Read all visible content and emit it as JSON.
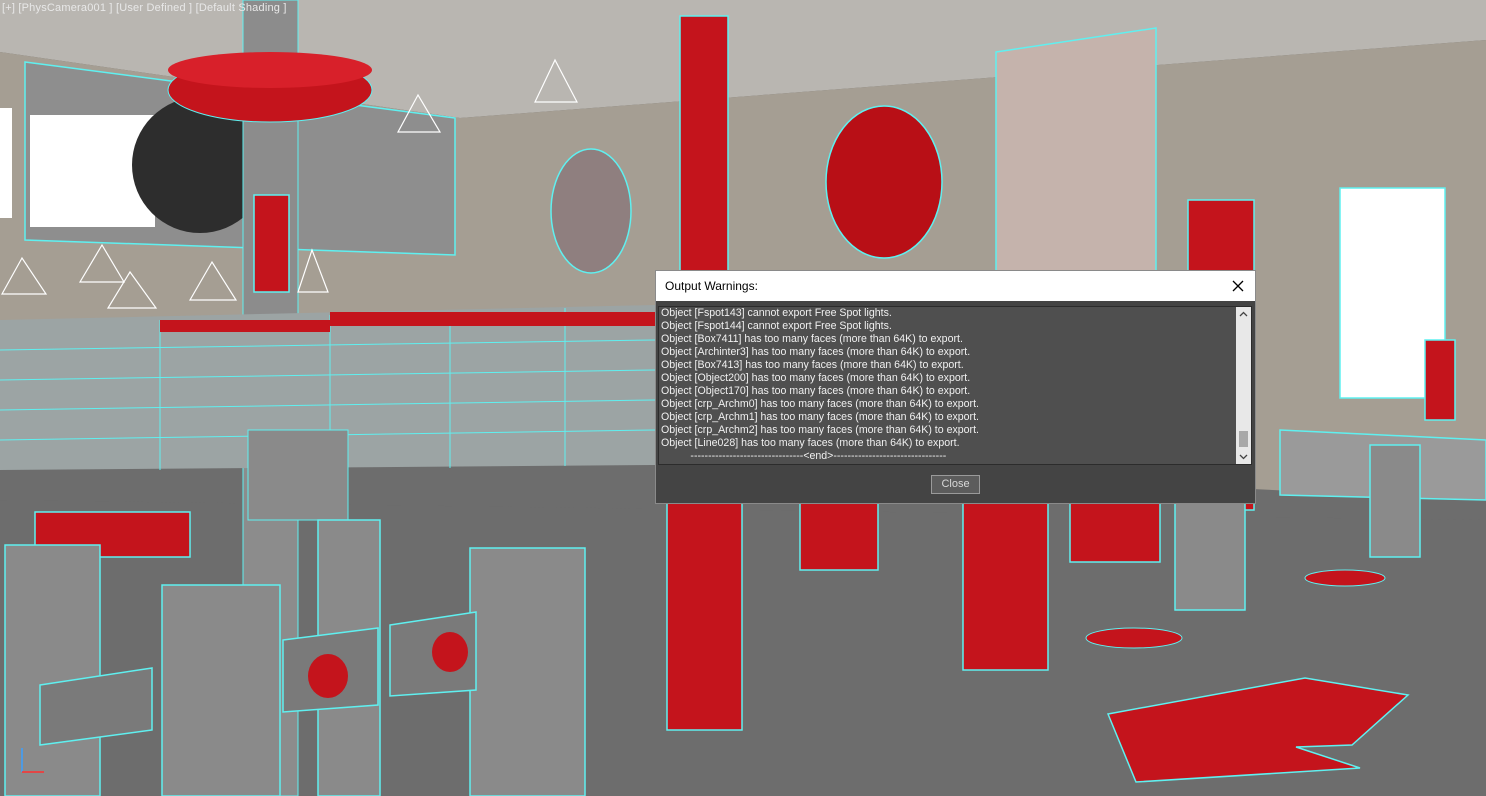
{
  "viewport": {
    "label": "[+] [PhysCamera001 ] [User Defined ] [Default Shading ]",
    "colors": {
      "floor": "#6d6d6d",
      "wall": "#a59e93",
      "ceiling": "#b9b6b1",
      "accent_red": "#d4101a",
      "wire": "#5ff0f0"
    }
  },
  "dialog": {
    "title": "Output Warnings:",
    "close_icon": "close-icon",
    "lines": [
      "Object [Fspot143] cannot export Free Spot lights.",
      "Object [Fspot144] cannot export Free Spot lights.",
      "Object [Box7411] has too many faces (more than 64K) to export.",
      "Object [Archinter3] has too many faces (more than 64K) to export.",
      "Object [Box7413] has too many faces (more than 64K) to export.",
      "Object [Object200] has too many faces (more than 64K) to export.",
      "Object [Object170] has too many faces (more than 64K) to export.",
      "Object [crp_Archm0] has too many faces (more than 64K) to export.",
      "Object [crp_Archm1] has too many faces (more than 64K) to export.",
      "Object [crp_Archm2] has too many faces (more than 64K) to export.",
      "Object [Line028] has too many faces (more than 64K) to export.",
      "          --------------------------------<end>--------------------------------"
    ],
    "close_label": "Close"
  }
}
